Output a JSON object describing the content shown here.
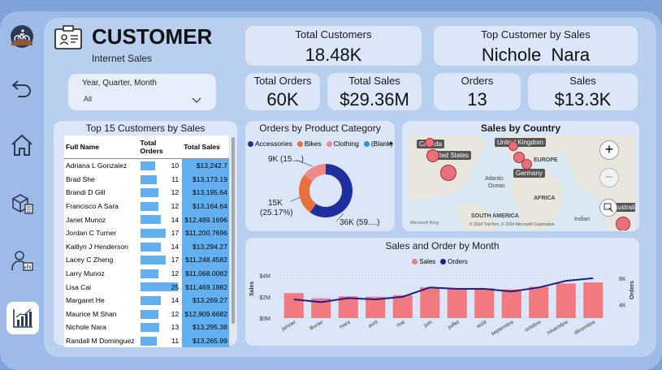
{
  "header": {
    "title": "CUSTOMER",
    "subtitle": "Internet Sales"
  },
  "filter": {
    "label": "Year, Quarter, Month",
    "value": "All"
  },
  "kpis": {
    "total_customers": {
      "label": "Total Customers",
      "value": "18.48K"
    },
    "top_customer": {
      "label": "Top Customer by Sales",
      "value": "Nichole  Nara"
    },
    "total_orders": {
      "label": "Total Orders",
      "value": "60K"
    },
    "total_sales": {
      "label": "Total Sales",
      "value": "$29.36M"
    },
    "orders": {
      "label": "Orders",
      "value": "13"
    },
    "sales": {
      "label": "Sales",
      "value": "$13.3K"
    }
  },
  "table": {
    "title": "Top 15 Customers by Sales",
    "headers": [
      "Full Name",
      "Total Orders",
      "Total Sales"
    ],
    "rows": [
      {
        "name": "Adriana L Gonzalez",
        "orders": 10,
        "sales": "$13,242.7"
      },
      {
        "name": "Brad She",
        "orders": 11,
        "sales": "$13,173.19"
      },
      {
        "name": "Brandi D Gill",
        "orders": 12,
        "sales": "$13,195.64"
      },
      {
        "name": "Francisco A Sara",
        "orders": 12,
        "sales": "$13,164.64"
      },
      {
        "name": "Janet Munoz",
        "orders": 14,
        "sales": "$12,489.1696"
      },
      {
        "name": "Jordan C Turner",
        "orders": 17,
        "sales": "$11,200.7696"
      },
      {
        "name": "Kaitlyn J Henderson",
        "orders": 14,
        "sales": "$13,294.27"
      },
      {
        "name": "Lacey C Zheng",
        "orders": 17,
        "sales": "$11,248.4582"
      },
      {
        "name": "Larry Munoz",
        "orders": 12,
        "sales": "$11,068.0082"
      },
      {
        "name": "Lisa Cai",
        "orders": 25,
        "sales": "$11,469.1882"
      },
      {
        "name": "Margaret He",
        "orders": 14,
        "sales": "$13,269.27"
      },
      {
        "name": "Maurice M Shan",
        "orders": 12,
        "sales": "$12,909.6682"
      },
      {
        "name": "Nichole Nara",
        "orders": 13,
        "sales": "$13,295.38"
      },
      {
        "name": "Randall M Dominguez",
        "orders": 11,
        "sales": "$13,265.99"
      }
    ]
  },
  "donut": {
    "title": "Orders by Product Category",
    "legend": [
      {
        "name": "Accessories",
        "color": "#1f2f9e"
      },
      {
        "name": "Bikes",
        "color": "#e8703a"
      },
      {
        "name": "Clothing",
        "color": "#f08a8a"
      },
      {
        "name": "(Blank)",
        "color": "#2f8fe0"
      }
    ],
    "labels": {
      "clothing": "9K (15....)",
      "bikes_value": "15K",
      "bikes_pct": "(25.17%)",
      "accessories": "36K (59....)"
    }
  },
  "map": {
    "title": "Sales by Country",
    "labels": [
      "Canada",
      "United States",
      "United Kingdom",
      "Germany",
      "Australia"
    ],
    "regions": [
      "EUROPE",
      "AFRICA",
      "SOUTH AMERICA",
      "Atlantic",
      "Ocean",
      "Indian"
    ],
    "credit_left": "Microsoft Bing",
    "credit_right": "© 2024 TomTom, © 2024 Microsoft Corporation"
  },
  "chart_data": [
    {
      "type": "pie",
      "title": "Orders by Product Category",
      "categories": [
        "Accessories",
        "Bikes",
        "Clothing"
      ],
      "values": [
        36,
        15,
        9
      ],
      "unit": "K"
    },
    {
      "type": "bar",
      "title": "Sales and Order by Month",
      "categories": [
        "janvier",
        "février",
        "mars",
        "avril",
        "mai",
        "juin",
        "juillet",
        "août",
        "septembre",
        "octobre",
        "novembre",
        "décembre"
      ],
      "series": [
        {
          "name": "Sales",
          "color": "#f07a80",
          "values": [
            2.35,
            1.85,
            2.05,
            2.0,
            2.15,
            2.9,
            2.75,
            2.8,
            2.7,
            2.95,
            3.25,
            3.35
          ]
        },
        {
          "name": "Orders",
          "color": "#1f1f8a",
          "type": "line",
          "values": [
            4.4,
            4.2,
            4.5,
            4.4,
            4.6,
            5.3,
            5.2,
            5.2,
            5.0,
            5.3,
            5.8,
            6.0
          ]
        }
      ],
      "ylabel": "Sales",
      "y2label": "Orders",
      "yticks": [
        "$0M",
        "$2M",
        "$4M"
      ],
      "y2ticks": [
        "4K",
        "6K"
      ],
      "ylim": [
        0,
        4.5
      ],
      "y2lim": [
        3,
        6.6
      ]
    }
  ]
}
